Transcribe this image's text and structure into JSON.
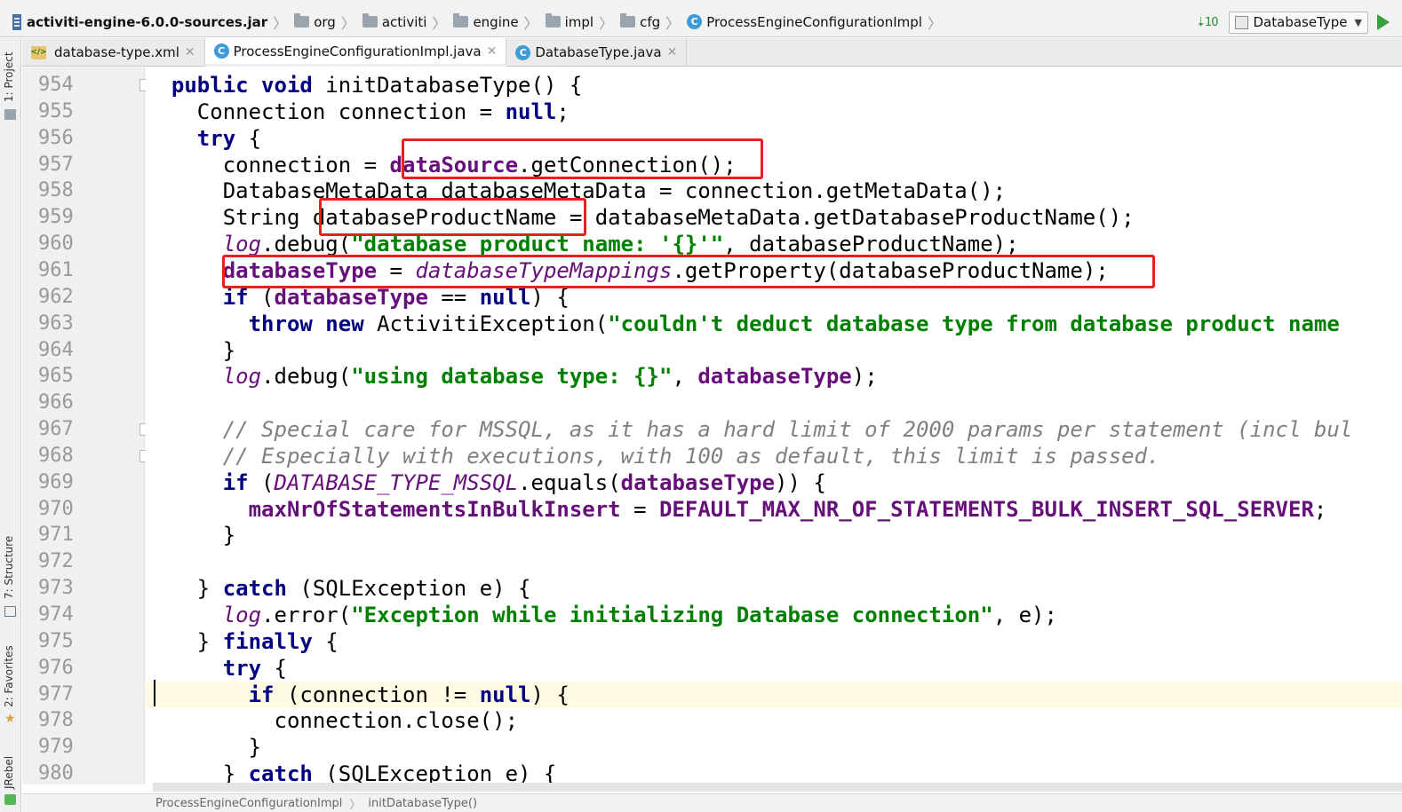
{
  "navbar": {
    "breadcrumbs": [
      {
        "label": "activiti-engine-6.0.0-sources.jar",
        "icon": "jar-icon"
      },
      {
        "label": "org",
        "icon": "folder-icon"
      },
      {
        "label": "activiti",
        "icon": "folder-icon"
      },
      {
        "label": "engine",
        "icon": "folder-icon"
      },
      {
        "label": "impl",
        "icon": "folder-icon"
      },
      {
        "label": "cfg",
        "icon": "folder-icon"
      },
      {
        "label": "ProcessEngineConfigurationImpl",
        "icon": "class-icon"
      }
    ],
    "run_config": "DatabaseType"
  },
  "toolwindows": {
    "project": "1: Project",
    "structure": "7: Structure",
    "favorites": "2: Favorites",
    "jrebel": "JRebel"
  },
  "tabs": [
    {
      "label": "database-type.xml",
      "icon": "xml-file-icon",
      "active": false
    },
    {
      "label": "ProcessEngineConfigurationImpl.java",
      "icon": "class-icon",
      "active": true
    },
    {
      "label": "DatabaseType.java",
      "icon": "class-icon",
      "active": false
    }
  ],
  "editor": {
    "line_numbers": [
      "954",
      "955",
      "956",
      "957",
      "958",
      "959",
      "960",
      "961",
      "962",
      "963",
      "964",
      "965",
      "966",
      "967",
      "968",
      "969",
      "970",
      "971",
      "972",
      "973",
      "974",
      "975",
      "976",
      "977",
      "978",
      "979",
      "980"
    ],
    "current_line": "977",
    "lines": [
      [
        {
          "t": "  "
        },
        {
          "t": "public void",
          "c": "kw"
        },
        {
          "t": " initDatabaseType() {"
        }
      ],
      [
        {
          "t": "    Connection connection = "
        },
        {
          "t": "null",
          "c": "kw"
        },
        {
          "t": ";"
        }
      ],
      [
        {
          "t": "    "
        },
        {
          "t": "try",
          "c": "kw"
        },
        {
          "t": " {"
        }
      ],
      [
        {
          "t": "      connection = "
        },
        {
          "t": "dataSource",
          "c": "fld"
        },
        {
          "t": ".getConnection();"
        }
      ],
      [
        {
          "t": "      DatabaseMetaData databaseMetaData = connection.getMetaData();"
        }
      ],
      [
        {
          "t": "      String databaseProductName = databaseMetaData.getDatabaseProductName();"
        }
      ],
      [
        {
          "t": "      "
        },
        {
          "t": "log",
          "c": "ital"
        },
        {
          "t": ".debug("
        },
        {
          "t": "\"database product name: '{}'\"",
          "c": "str"
        },
        {
          "t": ", databaseProductName);"
        }
      ],
      [
        {
          "t": "      "
        },
        {
          "t": "databaseType",
          "c": "fld"
        },
        {
          "t": " = "
        },
        {
          "t": "databaseTypeMappings",
          "c": "ital"
        },
        {
          "t": ".getProperty(databaseProductName);"
        }
      ],
      [
        {
          "t": "      "
        },
        {
          "t": "if",
          "c": "kw"
        },
        {
          "t": " ("
        },
        {
          "t": "databaseType",
          "c": "fld"
        },
        {
          "t": " == "
        },
        {
          "t": "null",
          "c": "kw"
        },
        {
          "t": ") {"
        }
      ],
      [
        {
          "t": "        "
        },
        {
          "t": "throw new",
          "c": "kw"
        },
        {
          "t": " ActivitiException("
        },
        {
          "t": "\"couldn't deduct database type from database product name",
          "c": "str"
        }
      ],
      [
        {
          "t": "      }"
        }
      ],
      [
        {
          "t": "      "
        },
        {
          "t": "log",
          "c": "ital"
        },
        {
          "t": ".debug("
        },
        {
          "t": "\"using database type: {}\"",
          "c": "str"
        },
        {
          "t": ", "
        },
        {
          "t": "databaseType",
          "c": "fld"
        },
        {
          "t": ");"
        }
      ],
      [
        {
          "t": ""
        }
      ],
      [
        {
          "t": "      "
        },
        {
          "t": "// Special care for MSSQL, as it has a hard limit of 2000 params per statement (incl bul",
          "c": "cmt"
        }
      ],
      [
        {
          "t": "      "
        },
        {
          "t": "// Especially with executions, with 100 as default, this limit is passed.",
          "c": "cmt"
        }
      ],
      [
        {
          "t": "      "
        },
        {
          "t": "if",
          "c": "kw"
        },
        {
          "t": " ("
        },
        {
          "t": "DATABASE_TYPE_MSSQL",
          "c": "ital"
        },
        {
          "t": ".equals("
        },
        {
          "t": "databaseType",
          "c": "fld"
        },
        {
          "t": ")) {"
        }
      ],
      [
        {
          "t": "        "
        },
        {
          "t": "maxNrOfStatementsInBulkInsert",
          "c": "fld"
        },
        {
          "t": " = "
        },
        {
          "t": "DEFAULT_MAX_NR_OF_STATEMENTS_BULK_INSERT_SQL_SERVER",
          "c": "fld"
        },
        {
          "t": ";"
        }
      ],
      [
        {
          "t": "      }"
        }
      ],
      [
        {
          "t": ""
        }
      ],
      [
        {
          "t": "    } "
        },
        {
          "t": "catch",
          "c": "kw"
        },
        {
          "t": " (SQLException e) {"
        }
      ],
      [
        {
          "t": "      "
        },
        {
          "t": "log",
          "c": "ital"
        },
        {
          "t": ".error("
        },
        {
          "t": "\"Exception while initializing Database connection\"",
          "c": "str"
        },
        {
          "t": ", e);"
        }
      ],
      [
        {
          "t": "    } "
        },
        {
          "t": "finally",
          "c": "kw"
        },
        {
          "t": " {"
        }
      ],
      [
        {
          "t": "      "
        },
        {
          "t": "try",
          "c": "kw"
        },
        {
          "t": " {"
        }
      ],
      [
        {
          "t": "        "
        },
        {
          "t": "if",
          "c": "kw"
        },
        {
          "t": " (connection != "
        },
        {
          "t": "null",
          "c": "kw"
        },
        {
          "t": ") {"
        }
      ],
      [
        {
          "t": "          connection.close();"
        }
      ],
      [
        {
          "t": "        }"
        }
      ],
      [
        {
          "t": "      } "
        },
        {
          "t": "catch",
          "c": "kw"
        },
        {
          "t": " (SQLException e) {"
        }
      ]
    ]
  },
  "status": {
    "crumbs": [
      "ProcessEngineConfigurationImpl",
      "initDatabaseType()"
    ]
  },
  "colors": {
    "keyword": "#000080",
    "string": "#008000",
    "field": "#660e7a",
    "comment": "#808080",
    "annotation_box": "#e8201d",
    "current_line": "#fffae3"
  }
}
